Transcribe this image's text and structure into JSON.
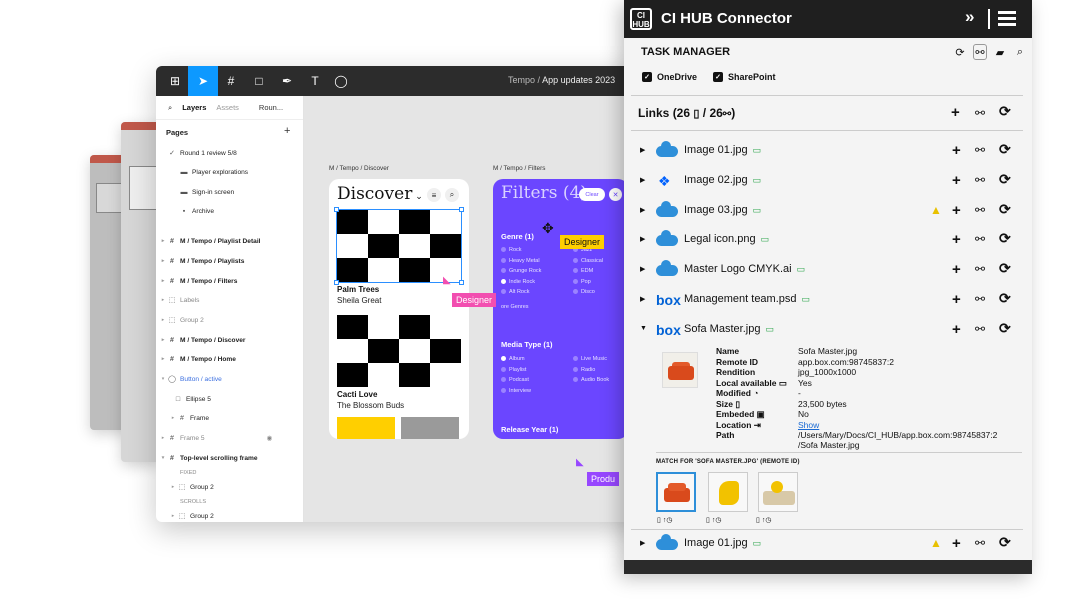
{
  "figma": {
    "tabs": {
      "layers": "Layers",
      "assets": "Assets",
      "page": "Roun..."
    },
    "breadcrumb": {
      "project": "Tempo",
      "separator": "/",
      "file": "App updates 2023"
    },
    "pages_heading": "Pages",
    "pages": [
      "Round 1 review 5/8",
      "Player explorations",
      "Sign-in screen",
      "Archive"
    ],
    "layers": [
      "M / Tempo / Playlist Detail",
      "M / Tempo / Playlists",
      "M / Tempo / Filters",
      "Labels",
      "Group 2",
      "M / Tempo / Discover",
      "M / Tempo / Home",
      "Button / active",
      "Ellipse 5",
      "Frame",
      "Frame 5",
      "Top-level scrolling frame",
      "FIXED",
      "Group 2",
      "SCROLLS",
      "Group 2"
    ],
    "frames": {
      "discover_label": "M / Tempo / Discover",
      "filters_label": "M / Tempo / Filters"
    },
    "discover": {
      "title": "Discover",
      "songs": [
        {
          "title": "Palm Trees",
          "artist": "Sheila Great"
        },
        {
          "title": "Cacti Love",
          "artist": "The Blossom Buds"
        }
      ]
    },
    "filters": {
      "title": "Filters (4)",
      "clear": "Clear",
      "genre_heading": "Genre (1)",
      "genres_left": [
        "Rock",
        "Heavy Metal",
        "Grunge Rock",
        "Indie Rock",
        "Alt Rock"
      ],
      "genres_right": [
        "Jazz",
        "Classical",
        "EDM",
        "Pop",
        "Disco"
      ],
      "more_genres": "ore Genres",
      "media_heading": "Media Type (1)",
      "media_left": [
        "Album",
        "Playlist",
        "Podcast",
        "Interview"
      ],
      "media_right": [
        "Live Music",
        "Radio",
        "Audio Book"
      ],
      "release_heading": "Release Year (1)"
    },
    "cursors": {
      "designer_pink": "Designer",
      "designer_yellow": "Designer",
      "product": "Produ"
    }
  },
  "cihub": {
    "title": "CI HUB Connector",
    "logo_text": "CI HUB",
    "task_manager": "TASK MANAGER",
    "sources": [
      "OneDrive",
      "SharePoint"
    ],
    "links": {
      "label": "Links",
      "open": "(26",
      "slash": "/ 26",
      "close": ")"
    },
    "rows": [
      {
        "name": "Image 01.jpg",
        "service": "onedrive",
        "warn": false
      },
      {
        "name": "Image 02.jpg",
        "service": "dropbox",
        "warn": false
      },
      {
        "name": "Image 03.jpg",
        "service": "onedrive",
        "warn": true
      },
      {
        "name": "Legal icon.png",
        "service": "onedrive",
        "warn": false
      },
      {
        "name": "Master Logo CMYK.ai",
        "service": "onedrive",
        "warn": false
      },
      {
        "name": "Management team.psd",
        "service": "box",
        "warn": false
      },
      {
        "name": "Sofa Master.jpg",
        "service": "box",
        "warn": false
      }
    ],
    "last_row": {
      "name": "Image 01.jpg",
      "service": "onedrive",
      "warn": true
    },
    "details": [
      {
        "key": "Name",
        "value": "Sofa Master.jpg"
      },
      {
        "key": "Remote ID",
        "value": "app.box.com:98745837:2"
      },
      {
        "key": "Rendition",
        "value": "jpg_1000x1000"
      },
      {
        "key": "Local available",
        "value": "Yes"
      },
      {
        "key": "Modified",
        "value": "-"
      },
      {
        "key": "Size",
        "value": "23,500 bytes"
      },
      {
        "key": "Embeded",
        "value": "No"
      },
      {
        "key": "Location",
        "value": "Show"
      },
      {
        "key": "Path",
        "value": "/Users/Mary/Docs/CI_HUB/app.box.com:98745837:2"
      },
      {
        "key": "",
        "value": "/Sofa Master.jpg"
      }
    ],
    "match_heading": "MATCH FOR 'SOFA MASTER.JPG' (REMOTE ID)"
  },
  "colors": {
    "figma_accent": "#0d99ff",
    "filters_bg": "#6b46ff",
    "cihub_header": "#1f1f1f",
    "onedrive": "#2e8fd9",
    "box": "#0061d5",
    "dropbox": "#0061fe",
    "warning": "#e8c100",
    "local_available": "#2aa44a"
  }
}
